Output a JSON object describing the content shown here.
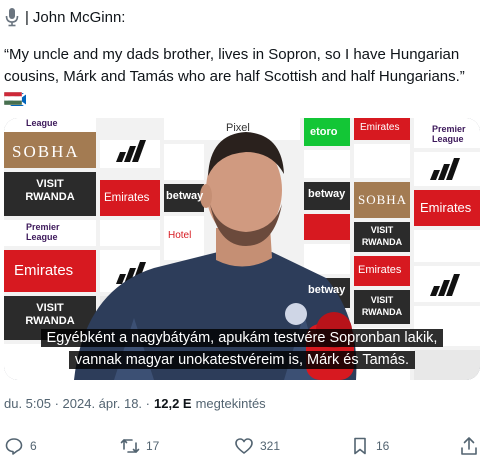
{
  "header": {
    "separator": "|",
    "author": "John McGinn:"
  },
  "quote": {
    "text": "“My uncle and my dads brother, lives in Sopron, so I have Hungarian cousins, Márk and Tamás who are half Scottish and half Hungarians.”"
  },
  "media": {
    "subtitle_line1": "Egyébként a nagybátyám, apukám testvére Sopronban lakik,",
    "subtitle_line2": "vannak magyar unokatestvéreim is, Márk és Tamás.",
    "boards": {
      "premier_league_top": "Premier",
      "premier_league_bottom": "League",
      "sobha": "SOBHA",
      "emirates": "Emirates",
      "visit": "VISIT",
      "rwanda": "RWANDA",
      "betway": "betway",
      "pixel": "Pixel",
      "etoro": "etoro",
      "hotels": "Hotel"
    }
  },
  "meta": {
    "time": "du. 5:05 · 2024. ápr. 18. ·",
    "views": "12,2 E",
    "views_label": "megtekintés"
  },
  "actions": {
    "replies": "6",
    "reposts": "17",
    "likes": "321",
    "bookmarks": "16"
  },
  "colors": {
    "muted": "#536471",
    "text": "#0f1419",
    "emirates_red": "#d71920",
    "pl_purple": "#3d195b",
    "etoro_green": "#13c636"
  }
}
